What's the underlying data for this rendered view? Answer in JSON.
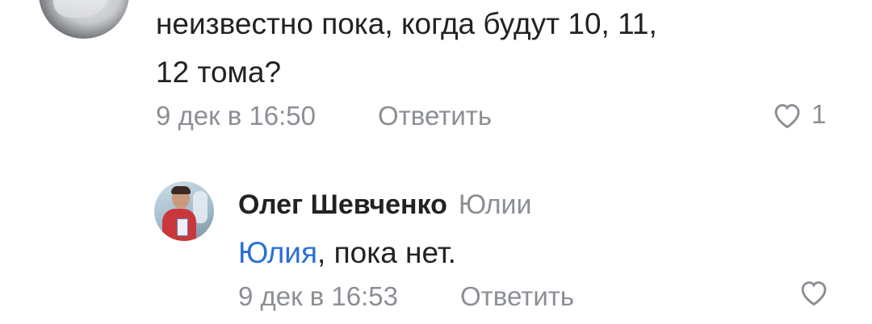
{
  "top_comment": {
    "text_line1": "неизвестно пока, когда будут 10, 11,",
    "text_line2": "12 тома?",
    "time": "9 дек в 16:50",
    "reply_label": "Ответить",
    "like_count": "1"
  },
  "reply_comment": {
    "author": "Олег Шевченко",
    "reply_to": "Юлии",
    "mention": "Юлия",
    "text": ", пока нет.",
    "time": "9 дек в 16:53",
    "reply_label": "Ответить"
  },
  "colors": {
    "text": "#222222",
    "muted": "#8b8f95",
    "mention": "#2a6fd6"
  }
}
